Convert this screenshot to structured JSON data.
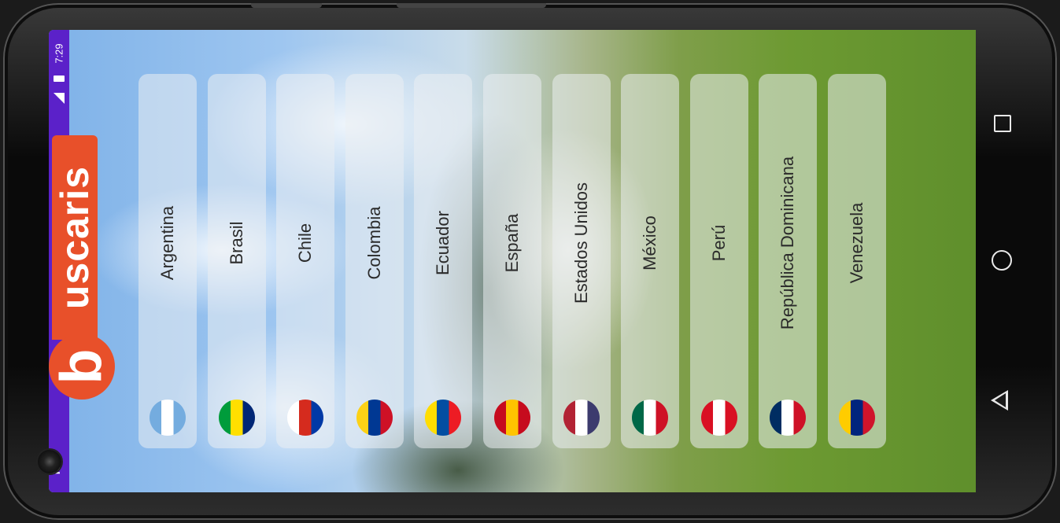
{
  "status_bar": {
    "time": "7:29"
  },
  "logo": {
    "mark": "b",
    "text": "uscaris"
  },
  "countries": [
    {
      "label": "Argentina",
      "flag": "argentina-flag",
      "colors": [
        "#74acdf",
        "#ffffff",
        "#74acdf"
      ]
    },
    {
      "label": "Brasil",
      "flag": "brazil-flag",
      "colors": [
        "#009c3b",
        "#ffdf00",
        "#002776"
      ]
    },
    {
      "label": "Chile",
      "flag": "chile-flag",
      "colors": [
        "#ffffff",
        "#d52b1e",
        "#0039a6"
      ]
    },
    {
      "label": "Colombia",
      "flag": "colombia-flag",
      "colors": [
        "#fcd116",
        "#003893",
        "#ce1126"
      ]
    },
    {
      "label": "Ecuador",
      "flag": "ecuador-flag",
      "colors": [
        "#ffdd00",
        "#034ea2",
        "#ed1c24"
      ]
    },
    {
      "label": "España",
      "flag": "spain-flag",
      "colors": [
        "#c60b1e",
        "#ffc400",
        "#c60b1e"
      ]
    },
    {
      "label": "Estados Unidos",
      "flag": "usa-flag",
      "colors": [
        "#b22234",
        "#ffffff",
        "#3c3b6e"
      ]
    },
    {
      "label": "México",
      "flag": "mexico-flag",
      "colors": [
        "#006847",
        "#ffffff",
        "#ce1126"
      ]
    },
    {
      "label": "Perú",
      "flag": "peru-flag",
      "colors": [
        "#d91023",
        "#ffffff",
        "#d91023"
      ]
    },
    {
      "label": "República Dominicana",
      "flag": "dominican-republic-flag",
      "colors": [
        "#002d62",
        "#ffffff",
        "#ce1126"
      ]
    },
    {
      "label": "Venezuela",
      "flag": "venezuela-flag",
      "colors": [
        "#ffcc00",
        "#00247d",
        "#cf142b"
      ]
    }
  ],
  "accent_color": "#e8502a",
  "status_bar_color": "#5b21c9"
}
